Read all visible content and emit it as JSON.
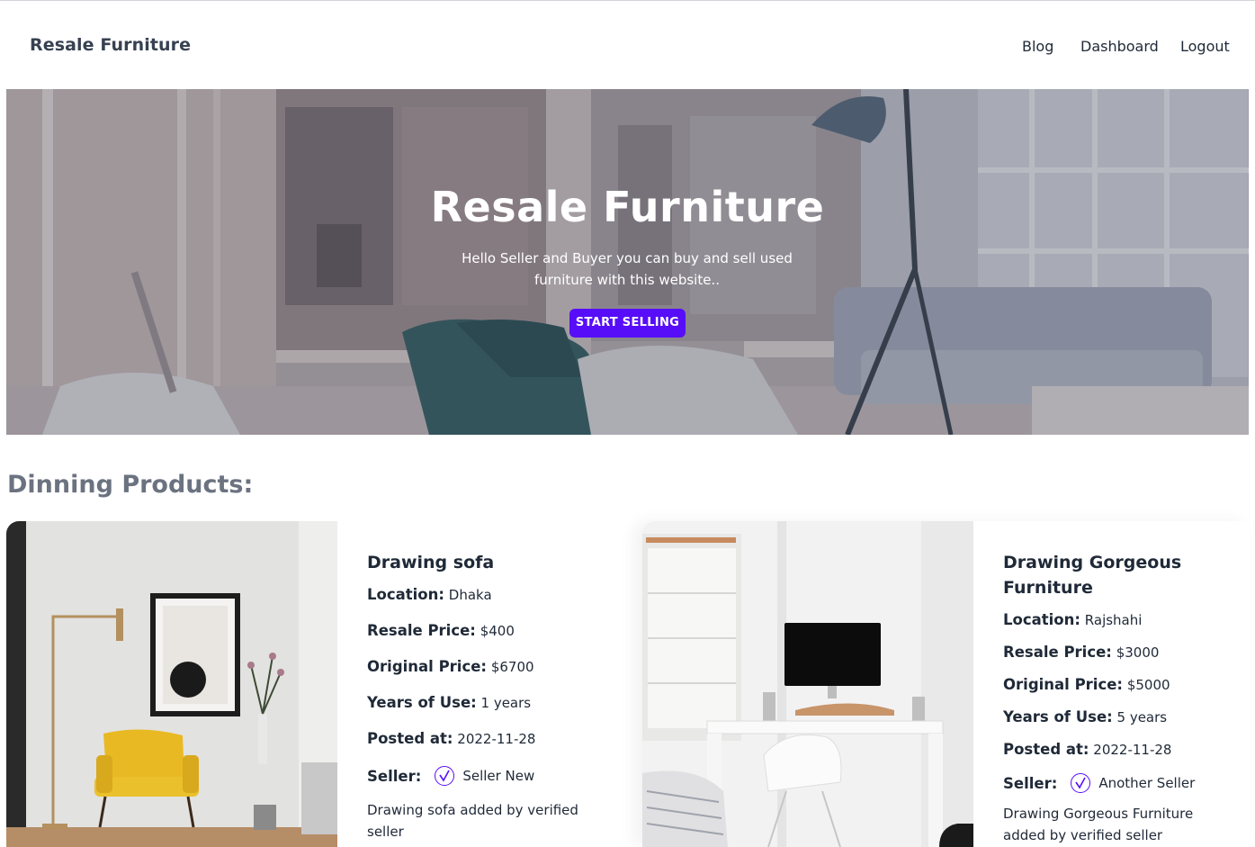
{
  "navbar": {
    "brand": "Resale Furniture",
    "links": [
      "Blog",
      "Dashboard",
      "Logout"
    ]
  },
  "hero": {
    "title": "Resale Furniture",
    "subtitle": "Hello Seller and Buyer you can buy and sell used furniture with this website..",
    "button_label": "START SELLING",
    "button_color": "#570df8"
  },
  "section": {
    "title": "Dinning Products:"
  },
  "labels": {
    "location": "Location:",
    "resale_price": "Resale Price:",
    "original_price": "Original Price:",
    "years_of_use": "Years of Use:",
    "posted_at": "Posted at:",
    "seller": "Seller:"
  },
  "products": [
    {
      "title": "Drawing sofa",
      "location": "Dhaka",
      "resale_price": "$400",
      "original_price": "$6700",
      "years_of_use": "1 years",
      "posted_at": "2022-11-28",
      "seller": "Seller New",
      "description": "Drawing sofa added by verified seller"
    },
    {
      "title": "Drawing Gorgeous Furniture",
      "location": "Rajshahi",
      "resale_price": "$3000",
      "original_price": "$5000",
      "years_of_use": "5 years",
      "posted_at": "2022-11-28",
      "seller": "Another Seller",
      "description": "Drawing Gorgeous Furniture added by verified seller"
    }
  ]
}
